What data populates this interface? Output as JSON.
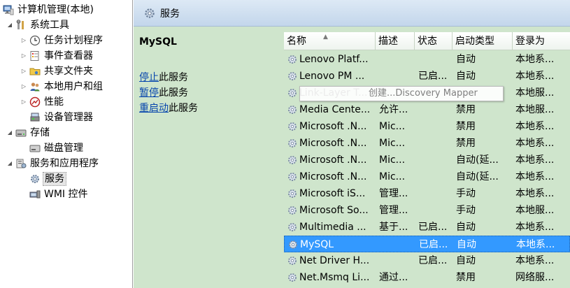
{
  "tree": {
    "root": "计算机管理(本地)",
    "system_tools": "系统工具",
    "task_scheduler": "任务计划程序",
    "event_viewer": "事件查看器",
    "shared_folders": "共享文件夹",
    "local_users": "本地用户和组",
    "performance": "性能",
    "device_manager": "设备管理器",
    "storage": "存储",
    "disk_management": "磁盘管理",
    "services_apps": "服务和应用程序",
    "services": "服务",
    "wmi": "WMI 控件"
  },
  "header": {
    "title": "服务"
  },
  "side": {
    "service_name": "MySQL",
    "stop_link": "停止",
    "stop_suffix": "此服务",
    "pause_link": "暂停",
    "pause_suffix": "此服务",
    "restart_link": "重启动",
    "restart_suffix": "此服务"
  },
  "columns": {
    "name": "名称",
    "desc": "描述",
    "status": "状态",
    "startup": "启动类型",
    "logon": "登录为"
  },
  "tooltip": "创建...Discovery Mapper",
  "rows": [
    {
      "name": "Lenovo Platf...",
      "desc": "",
      "status": "",
      "startup": "自动",
      "logon": "本地系..."
    },
    {
      "name": "Lenovo PM ...",
      "desc": "",
      "status": "已启...",
      "startup": "自动",
      "logon": "本地系..."
    },
    {
      "name": "Link-Layer T...",
      "desc": "",
      "status": "",
      "startup": "",
      "logon": "本地服..."
    },
    {
      "name": "Media Cente...",
      "desc": "允许...",
      "status": "",
      "startup": "禁用",
      "logon": "本地服..."
    },
    {
      "name": "Microsoft .N...",
      "desc": "Mic...",
      "status": "",
      "startup": "禁用",
      "logon": "本地系..."
    },
    {
      "name": "Microsoft .N...",
      "desc": "Mic...",
      "status": "",
      "startup": "禁用",
      "logon": "本地系..."
    },
    {
      "name": "Microsoft .N...",
      "desc": "Mic...",
      "status": "",
      "startup": "自动(延...",
      "logon": "本地系..."
    },
    {
      "name": "Microsoft .N...",
      "desc": "Mic...",
      "status": "",
      "startup": "自动(延...",
      "logon": "本地系..."
    },
    {
      "name": "Microsoft iS...",
      "desc": "管理...",
      "status": "",
      "startup": "手动",
      "logon": "本地系..."
    },
    {
      "name": "Microsoft So...",
      "desc": "管理...",
      "status": "",
      "startup": "手动",
      "logon": "本地服..."
    },
    {
      "name": "Multimedia ...",
      "desc": "基于...",
      "status": "已启...",
      "startup": "自动",
      "logon": "本地系..."
    },
    {
      "name": "MySQL",
      "desc": "",
      "status": "已启...",
      "startup": "自动",
      "logon": "本地系..."
    },
    {
      "name": "Net Driver H...",
      "desc": "",
      "status": "已启...",
      "startup": "自动",
      "logon": "本地系..."
    },
    {
      "name": "Net.Msmq Li...",
      "desc": "通过...",
      "status": "",
      "startup": "禁用",
      "logon": "网络服..."
    }
  ],
  "colors": {
    "pane_bg": "#cfe5cc",
    "selection": "#3399ff",
    "link": "#0645ad"
  }
}
